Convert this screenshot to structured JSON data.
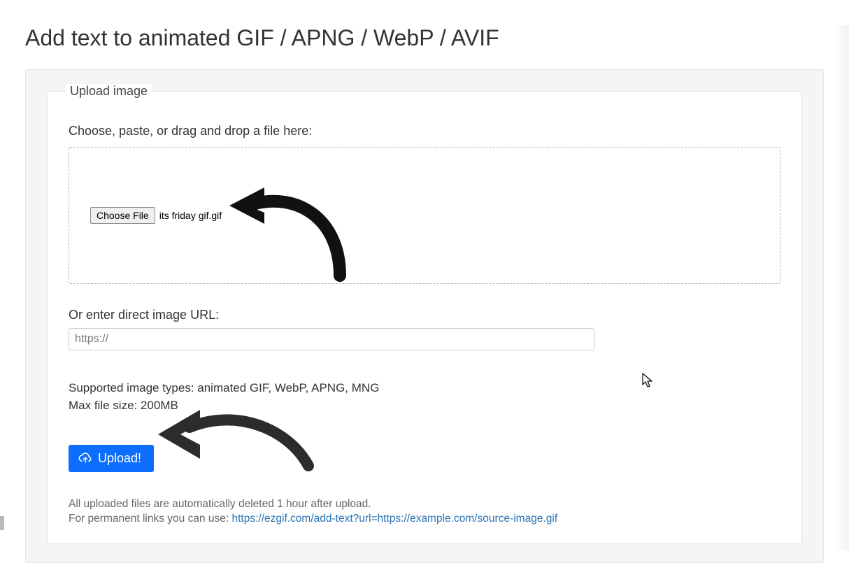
{
  "page": {
    "title": "Add text to animated GIF / APNG / WebP / AVIF"
  },
  "upload": {
    "legend": "Upload image",
    "file_label": "Choose, paste, or drag and drop a file here:",
    "choose_button": "Choose File",
    "chosen_filename": "its friday gif.gif",
    "url_label": "Or enter direct image URL:",
    "url_placeholder": "https://",
    "url_value": "",
    "supported_line": "Supported image types: animated GIF, WebP, APNG, MNG",
    "maxsize_line": "Max file size: 200MB",
    "upload_button": "Upload!",
    "notice_line1": "All uploaded files are automatically deleted 1 hour after upload.",
    "notice_line2_prefix": "For permanent links you can use: ",
    "notice_line2_link": "https://ezgif.com/add-text?url=https://example.com/source-image.gif"
  },
  "icons": {
    "upload": "cloud-upload-icon",
    "cursor": "mouse-cursor-icon"
  }
}
